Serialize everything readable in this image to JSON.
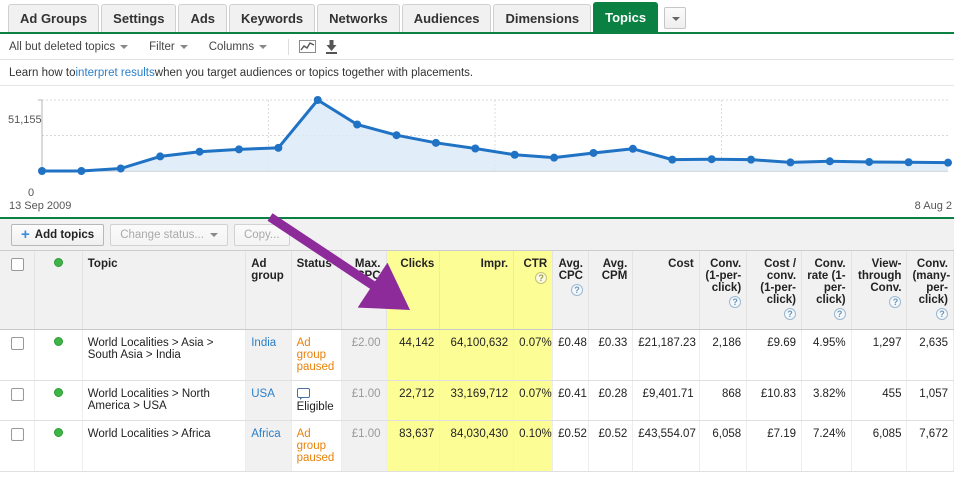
{
  "tabs": [
    {
      "label": "Ad Groups",
      "active": false
    },
    {
      "label": "Settings",
      "active": false
    },
    {
      "label": "Ads",
      "active": false
    },
    {
      "label": "Keywords",
      "active": false
    },
    {
      "label": "Networks",
      "active": false
    },
    {
      "label": "Audiences",
      "active": false
    },
    {
      "label": "Dimensions",
      "active": false
    },
    {
      "label": "Topics",
      "active": true
    }
  ],
  "tab_overflow_icon": "chevron-down-icon",
  "toolbar": {
    "filter_scope": "All but deleted topics",
    "filter": "Filter",
    "columns": "Columns",
    "chart_icon": "line-chart-icon",
    "download_icon": "download-icon"
  },
  "info": {
    "prefix": "Learn how to ",
    "link": "interpret results",
    "suffix": " when you target audiences or topics together with placements."
  },
  "chart_data": {
    "type": "area",
    "title": "",
    "xlabel": "",
    "ylabel": "",
    "y_ticks": [
      "0",
      "51,155"
    ],
    "ylim": [
      0,
      51155
    ],
    "x_start_label": "13 Sep 2009",
    "x_end_label": "8 Aug 2",
    "grid": true,
    "legend": "none",
    "line_color": "#1f72c4",
    "fill_color": "#dceaf7",
    "x": [
      0,
      1,
      2,
      3,
      4,
      5,
      6,
      7,
      8,
      9,
      10,
      11,
      12,
      13,
      14,
      15,
      16,
      17,
      18,
      19,
      20,
      21,
      22,
      23
    ],
    "values": [
      0,
      0,
      1800,
      10500,
      13900,
      15600,
      16700,
      51155,
      33500,
      25800,
      20300,
      16200,
      11700,
      9600,
      13000,
      16000,
      8200,
      8500,
      8200,
      6200,
      7000,
      6500,
      6300,
      6000
    ]
  },
  "actionbar": {
    "add_topics": "Add topics",
    "change_status": "Change status...",
    "copy": "Copy..."
  },
  "table": {
    "columns": [
      {
        "key": "checkbox",
        "label": "",
        "align": "c",
        "highlight": false
      },
      {
        "key": "status_dot",
        "label": "",
        "align": "c",
        "highlight": false
      },
      {
        "key": "topic",
        "label": "Topic",
        "align": "l",
        "highlight": false
      },
      {
        "key": "ad_group",
        "label": "Ad group",
        "align": "l",
        "highlight": false
      },
      {
        "key": "status",
        "label": "Status",
        "align": "l",
        "highlight": false
      },
      {
        "key": "max_cpc",
        "label": "Max. CPC",
        "align": "r",
        "highlight": false
      },
      {
        "key": "clicks",
        "label": "Clicks",
        "align": "r",
        "highlight": true
      },
      {
        "key": "impr",
        "label": "Impr.",
        "align": "r",
        "highlight": true
      },
      {
        "key": "ctr",
        "label": "CTR",
        "align": "r",
        "highlight": true,
        "help": true
      },
      {
        "key": "avg_cpc",
        "label": "Avg. CPC",
        "align": "r",
        "highlight": false,
        "help": true
      },
      {
        "key": "avg_cpm",
        "label": "Avg. CPM",
        "align": "r",
        "highlight": false
      },
      {
        "key": "cost",
        "label": "Cost",
        "align": "r",
        "highlight": false
      },
      {
        "key": "conv_1pc",
        "label": "Conv. (1-per-click)",
        "align": "r",
        "highlight": false,
        "help": true
      },
      {
        "key": "cost_conv_1pc",
        "label": "Cost / conv. (1-per-click)",
        "align": "r",
        "highlight": false,
        "help": true
      },
      {
        "key": "conv_rate_1pc",
        "label": "Conv. rate (1-per-click)",
        "align": "r",
        "highlight": false,
        "help": true
      },
      {
        "key": "view_through",
        "label": "View-through Conv.",
        "align": "r",
        "highlight": false,
        "help": true
      },
      {
        "key": "conv_manypc",
        "label": "Conv. (many-per-click)",
        "align": "r",
        "highlight": false,
        "help": true
      }
    ],
    "rows": [
      {
        "topic": "World Localities > Asia > South Asia > India",
        "ad_group": "India",
        "status": "Ad group paused",
        "status_type": "paused",
        "max_cpc": "£2.00",
        "clicks": "44,142",
        "impr": "64,100,632",
        "ctr": "0.07%",
        "avg_cpc": "£0.48",
        "avg_cpm": "£0.33",
        "cost": "£21,187.23",
        "conv_1pc": "2,186",
        "cost_conv_1pc": "£9.69",
        "conv_rate_1pc": "4.95%",
        "view_through": "1,297",
        "conv_manypc": "2,635"
      },
      {
        "topic": "World Localities > North America > USA",
        "ad_group": "USA",
        "status": "Eligible",
        "status_type": "eligible",
        "max_cpc": "£1.00",
        "clicks": "22,712",
        "impr": "33,169,712",
        "ctr": "0.07%",
        "avg_cpc": "£0.41",
        "avg_cpm": "£0.28",
        "cost": "£9,401.71",
        "conv_1pc": "868",
        "cost_conv_1pc": "£10.83",
        "conv_rate_1pc": "3.82%",
        "view_through": "455",
        "conv_manypc": "1,057"
      },
      {
        "topic": "World Localities > Africa",
        "ad_group": "Africa",
        "status": "Ad group paused",
        "status_type": "paused",
        "max_cpc": "£1.00",
        "clicks": "83,637",
        "impr": "84,030,430",
        "ctr": "0.10%",
        "avg_cpc": "£0.52",
        "avg_cpm": "£0.52",
        "cost": "£43,554.07",
        "conv_1pc": "6,058",
        "cost_conv_1pc": "£7.19",
        "conv_rate_1pc": "7.24%",
        "view_through": "6,085",
        "conv_manypc": "7,672"
      }
    ]
  },
  "annotation": {
    "arrow_color": "#8e2b9a",
    "points_at": "clicks"
  }
}
